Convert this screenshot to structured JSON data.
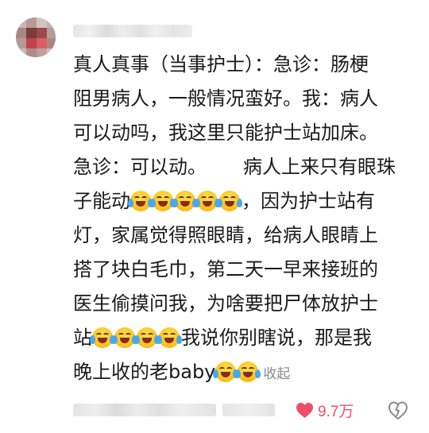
{
  "comment": {
    "lines": [
      "真人真事（当事护士）：急诊：肠梗",
      "阻男病人，一般情况蛮好。我：病人",
      "可以动吗，我这里只能护士站加床。",
      {
        "a": "急诊：可以动。",
        "b": "病人上来只有眼珠"
      },
      {
        "a": "子能动",
        "b": "，因为护士站有"
      },
      "灯，家属觉得照眼睛，给病人眼睛上",
      "搭了块白毛巾，第二天一早来接班的",
      "医生偷摸问我，为啥要把尸体放护士",
      {
        "a": "站",
        "b": "我说你别瞎说，那是我"
      },
      {
        "a": "晚上收的老baby"
      }
    ],
    "emoji": "face-with-tears-of-joy-icon",
    "collapse_label": "收起",
    "likes": "9.7万",
    "like_color": "#ef4e68",
    "text_color": "#1a1a1a",
    "secondary_color": "#8a8a8a"
  }
}
